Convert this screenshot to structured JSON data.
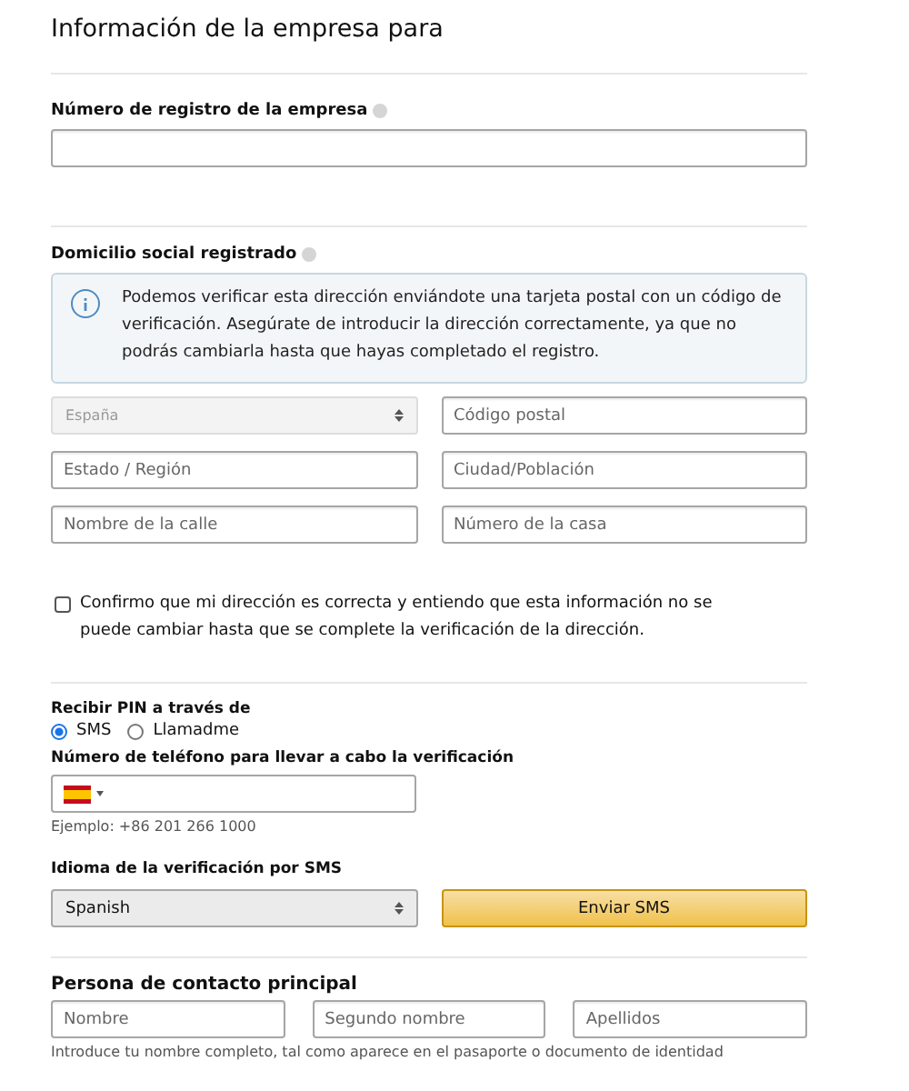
{
  "title": "Información de la empresa para",
  "registration": {
    "label": "Número de registro de la empresa"
  },
  "address": {
    "label": "Domicilio social registrado",
    "notice": "Podemos verificar esta dirección enviándote una tarjeta postal con un código de verificación. Asegúrate de introducir la dirección correctamente, ya que no podrás cambiarla hasta que hayas completado el registro.",
    "fields": [
      {
        "kind": "select",
        "value": "España",
        "disabled": true
      },
      {
        "kind": "text",
        "placeholder": "Código postal"
      },
      {
        "kind": "text",
        "placeholder": "Estado / Región"
      },
      {
        "kind": "text",
        "placeholder": "Ciudad/Población"
      },
      {
        "kind": "text",
        "placeholder": "Nombre de la calle"
      },
      {
        "kind": "text",
        "placeholder": "Número de la casa"
      }
    ],
    "confirm": {
      "label": "Confirmo que mi dirección es correcta y entiendo que esta información no se puede cambiar hasta que se complete la verificación de la dirección.",
      "checked": false
    }
  },
  "pin": {
    "label": "Recibir PIN a través de",
    "options": [
      {
        "label": "SMS",
        "selected": true
      },
      {
        "label": "Llamadme",
        "selected": false
      }
    ],
    "phone_label": "Número de teléfono para llevar a cabo la verificación",
    "phone_hint": "Ejemplo: +86 201 266 1000",
    "language_label": "Idioma de la verificación por SMS",
    "language": "Spanish",
    "send_button": "Enviar SMS"
  },
  "contact": {
    "label": "Persona de contacto principal",
    "fields": [
      {
        "placeholder": "Nombre"
      },
      {
        "placeholder": "Segundo nombre"
      },
      {
        "placeholder": "Apellidos"
      }
    ],
    "hint": "Introduce tu nombre completo, tal como aparece en el pasaporte o documento de identidad"
  }
}
